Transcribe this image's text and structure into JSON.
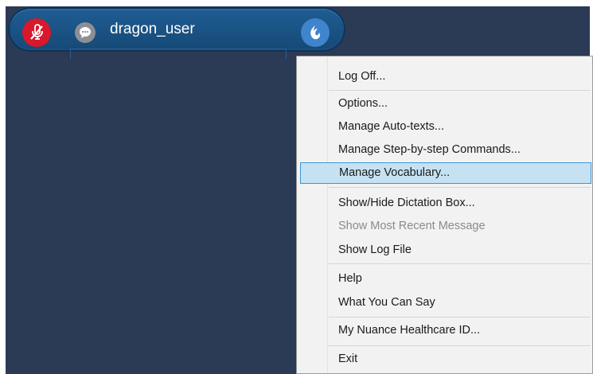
{
  "bar": {
    "username": "dragon_user",
    "icons": {
      "mic": "microphone-off-icon",
      "message": "speech-bubble-icon",
      "dragon": "dragon-flame-icon"
    },
    "colors": {
      "bar": "#1a4f7f",
      "mic": "#d8182b",
      "dragon": "#3f84cc"
    }
  },
  "menu": {
    "items": [
      {
        "label": "Log Off...",
        "enabled": true
      },
      {
        "label": "Options...",
        "enabled": true
      },
      {
        "label": "Manage Auto-texts...",
        "enabled": true
      },
      {
        "label": "Manage Step-by-step Commands...",
        "enabled": true
      },
      {
        "label": "Manage Vocabulary...",
        "enabled": true,
        "selected": true
      },
      {
        "label": "Show/Hide Dictation Box...",
        "enabled": true
      },
      {
        "label": "Show Most Recent Message",
        "enabled": false
      },
      {
        "label": "Show Log File",
        "enabled": true
      },
      {
        "label": "Help",
        "enabled": true
      },
      {
        "label": "What You Can Say",
        "enabled": true
      },
      {
        "label": "My Nuance Healthcare ID...",
        "enabled": true
      },
      {
        "label": "Exit",
        "enabled": true
      }
    ]
  }
}
